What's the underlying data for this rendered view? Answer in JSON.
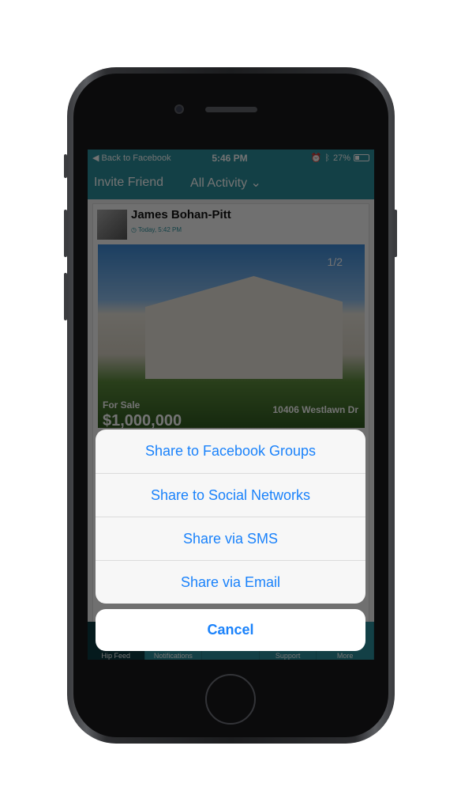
{
  "status_bar": {
    "back": "◀ Back to Facebook",
    "time": "5:46 PM",
    "battery": "27%",
    "battery_level": 27
  },
  "nav": {
    "invite": "Invite Friend",
    "filter": "All Activity",
    "filter_chevron": "⌄"
  },
  "post": {
    "author": "James Bohan-Pitt",
    "time": "◷ Today, 5:42 PM",
    "photo_counter": "1/2",
    "status": "For Sale",
    "address": "10406 Westlawn Dr",
    "price": "$1,000,000"
  },
  "tabbar": {
    "items": [
      "Hip Feed",
      "Notifications",
      "",
      "Support",
      "More"
    ]
  },
  "action_sheet": {
    "options": [
      "Share to Facebook Groups",
      "Share to Social Networks",
      "Share via SMS",
      "Share via Email"
    ],
    "cancel": "Cancel"
  },
  "colors": {
    "accent": "#2a8f9b",
    "ios_blue": "#1a82fb"
  }
}
